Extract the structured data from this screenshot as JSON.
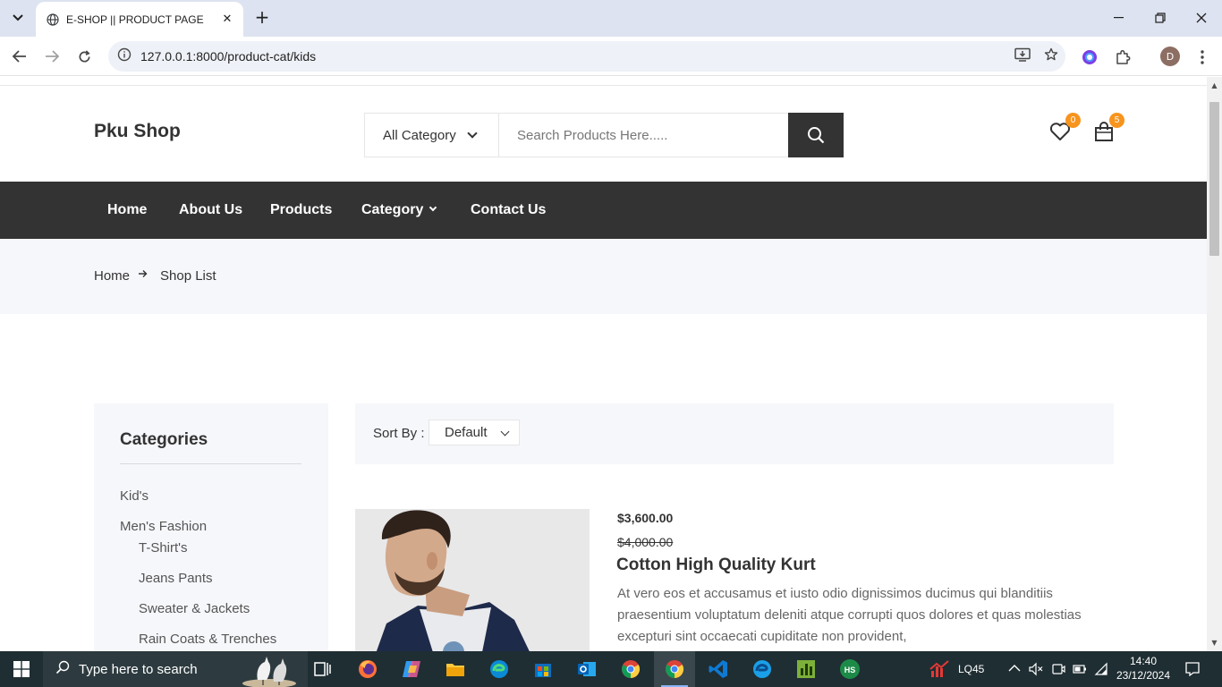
{
  "browser": {
    "tab_title": "E-SHOP || PRODUCT PAGE",
    "url": "127.0.0.1:8000/product-cat/kids",
    "profile_initial": "D"
  },
  "header": {
    "logo": "Pku Shop",
    "category_select": "All Category",
    "search_placeholder": "Search Products Here.....",
    "wishlist_count": "0",
    "cart_count": "5"
  },
  "nav": {
    "items": [
      "Home",
      "About Us",
      "Products",
      "Category",
      "Contact Us"
    ]
  },
  "breadcrumb": {
    "home": "Home",
    "current": "Shop List"
  },
  "sidebar": {
    "title": "Categories",
    "items": [
      {
        "label": "Kid's"
      },
      {
        "label": "Men's Fashion"
      },
      {
        "label": "T-Shirt's"
      },
      {
        "label": "Jeans Pants"
      },
      {
        "label": "Sweater & Jackets"
      },
      {
        "label": "Rain Coats & Trenches"
      }
    ]
  },
  "sort": {
    "label": "Sort By :",
    "value": "Default"
  },
  "product": {
    "price": "$3,600.00",
    "old_price": "$4,000.00",
    "name": "Cotton High Quality Kurt",
    "description": "At vero eos et accusamus et iusto odio dignissimos ducimus qui blanditiis praesentium voluptatum deleniti atque corrupti quos dolores et quas molestias excepturi sint occaecati cupiditate non provident,"
  },
  "taskbar": {
    "search_placeholder": "Type here to search",
    "stock_label": "LQ45",
    "time": "14:40",
    "date": "23/12/2024"
  },
  "colors": {
    "accent": "#f7941d",
    "dark": "#333333",
    "light_bg": "#f6f7fb"
  }
}
